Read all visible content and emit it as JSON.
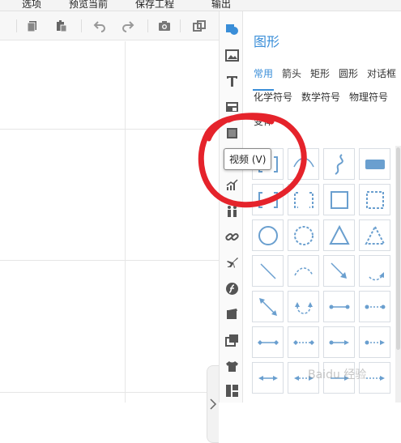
{
  "menu": [
    "选项",
    "预览当前",
    "保存工程",
    "输出"
  ],
  "toolbar": {
    "icons": [
      "copy-icon",
      "paste-icon",
      "undo-icon",
      "redo-icon",
      "camera-icon",
      "layers-icon"
    ]
  },
  "sidebar": {
    "icons": [
      "shape-icon",
      "image-icon",
      "text-icon",
      "media-icon",
      "video-icon",
      "chart-icon",
      "people-icon",
      "link-icon",
      "plane-icon",
      "flash-icon",
      "scene-icon",
      "gallery-icon",
      "shirt-icon",
      "layout-icon"
    ]
  },
  "tooltip": "视频 (V)",
  "panel": {
    "title": "图形",
    "tabs_row1": [
      "常用",
      "箭头",
      "矩形",
      "圆形",
      "对话框"
    ],
    "tabs_row2": [
      "化学符号",
      "数学符号",
      "物理符号"
    ],
    "tabs_row3": [
      "变体"
    ],
    "active_tab": "常用"
  },
  "colors": {
    "accent": "#3a8ed8",
    "shape": "#6a9fcf",
    "annotation": "#e5232b"
  },
  "watermark": "Baidu 经验"
}
